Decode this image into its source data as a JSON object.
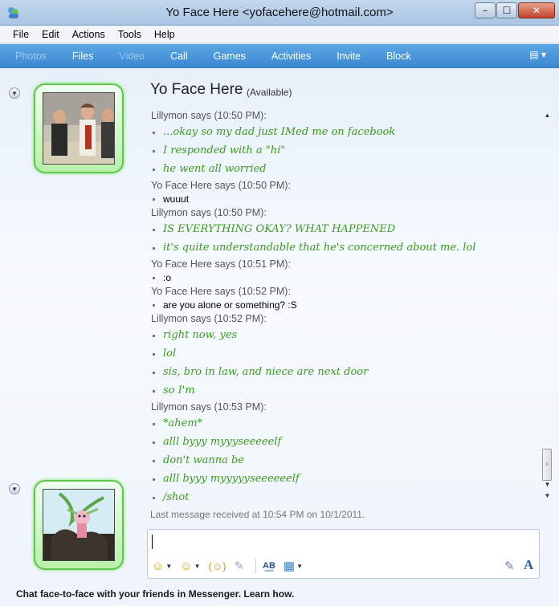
{
  "window": {
    "title": "Yo Face Here <yofacehere@hotmail.com>",
    "minimize": "–",
    "maximize": "☐",
    "close": "✕"
  },
  "menu": [
    "File",
    "Edit",
    "Actions",
    "Tools",
    "Help"
  ],
  "toolbar": {
    "items": [
      {
        "label": "Photos",
        "enabled": false
      },
      {
        "label": "Files",
        "enabled": true
      },
      {
        "label": "Video",
        "enabled": false
      },
      {
        "label": "Call",
        "enabled": true
      },
      {
        "label": "Games",
        "enabled": true
      },
      {
        "label": "Activities",
        "enabled": true
      },
      {
        "label": "Invite",
        "enabled": true
      },
      {
        "label": "Block",
        "enabled": true
      }
    ],
    "menu_icon": "show-menu-icon"
  },
  "contact": {
    "name": "Yo Face Here",
    "status": "(Available)"
  },
  "conversation": [
    {
      "header": "Lillymon says (10:50 PM):",
      "sender": "lilly",
      "lines": [
        "...okay so my dad just IMed me on facebook",
        "I responded with a \"hi\"",
        "he went all worried"
      ]
    },
    {
      "header": "Yo Face Here says (10:50 PM):",
      "sender": "yo",
      "lines": [
        "wuuut"
      ]
    },
    {
      "header": "Lillymon says (10:50 PM):",
      "sender": "lilly",
      "lines": [
        "IS EVERYTHING OKAY? WHAT HAPPENED",
        "it's quite understandable that he's concerned about me. lol"
      ]
    },
    {
      "header": "Yo Face Here says (10:51 PM):",
      "sender": "yo",
      "lines": [
        ":o"
      ]
    },
    {
      "header": "Yo Face Here says (10:52 PM):",
      "sender": "yo",
      "lines": [
        "are you alone or something? :S"
      ]
    },
    {
      "header": "Lillymon says (10:52 PM):",
      "sender": "lilly",
      "lines": [
        "right now, yes",
        "lol",
        "sis, bro in law, and niece are next door",
        "so I'm"
      ]
    },
    {
      "header": "Lillymon says (10:53 PM):",
      "sender": "lilly",
      "lines": [
        "*ahem*",
        "alll byyy myyyseeeeelf",
        "don't wanna be",
        "alll byyy myyyyyseeeeeelf",
        "/shot"
      ]
    }
  ],
  "last_message": "Last message received at 10:54 PM on 10/1/2011.",
  "input": {
    "value": ""
  },
  "input_toolbar": {
    "emoticon": "☺",
    "wink": "☺",
    "nudge": "(☺)",
    "voice_clip": "✎",
    "spelling": "A͟B",
    "background": "▦"
  },
  "footer": "Chat face-to-face with your friends in Messenger. Learn how.",
  "colors": {
    "lilly_text": "#3a9b1c",
    "toolbar": "#3b86cf",
    "avatar_frame": "#5dc84a"
  }
}
